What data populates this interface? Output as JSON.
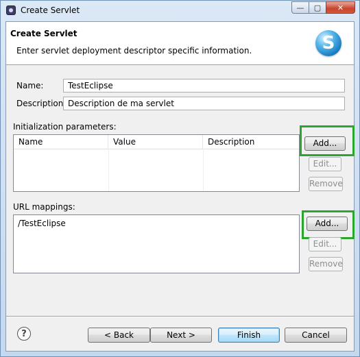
{
  "window": {
    "title": "Create Servlet",
    "controls": {
      "minimize": "—",
      "maximize": "▢",
      "close": "✕"
    }
  },
  "banner": {
    "title": "Create Servlet",
    "description": "Enter servlet deployment descriptor specific information.",
    "logo_letter": "S"
  },
  "form": {
    "name_label": "Name:",
    "name_value": "TestEclipse",
    "description_label": "Description:",
    "description_value": "Description de ma servlet"
  },
  "init_params": {
    "label": "Initialization parameters:",
    "columns": [
      "Name",
      "Value",
      "Description"
    ],
    "add_label": "Add...",
    "edit_label": "Edit...",
    "remove_label": "Remove"
  },
  "url_mappings": {
    "label": "URL mappings:",
    "items": [
      "/TestEclipse"
    ],
    "add_label": "Add...",
    "edit_label": "Edit...",
    "remove_label": "Remove"
  },
  "footer": {
    "help_icon": "?",
    "back_label": "< Back",
    "next_label": "Next >",
    "finish_label": "Finish",
    "cancel_label": "Cancel"
  },
  "colors": {
    "highlight": "#2aa52e",
    "default_button": "#3c7fb1"
  }
}
